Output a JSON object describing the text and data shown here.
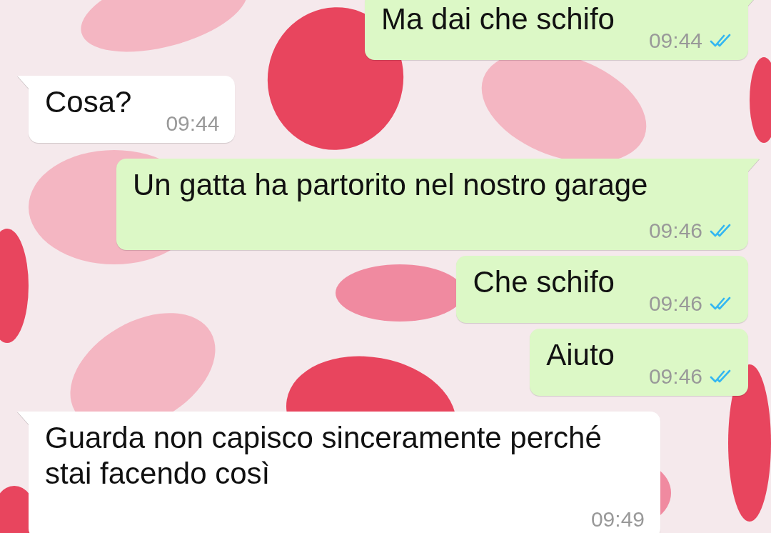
{
  "messages": [
    {
      "outgoing": true,
      "text": "Ma dai che schifo",
      "time": "09:44",
      "read": true
    },
    {
      "outgoing": false,
      "text": "Cosa?",
      "time": "09:44"
    },
    {
      "outgoing": true,
      "text": "Un gatta ha partorito nel nostro garage",
      "time": "09:46",
      "read": true
    },
    {
      "outgoing": true,
      "text": "Che schifo",
      "time": "09:46",
      "read": true
    },
    {
      "outgoing": true,
      "text": "Aiuto",
      "time": "09:46",
      "read": true
    },
    {
      "outgoing": false,
      "text": "Guarda non capisco sinceramente perché stai facendo così",
      "time": "09:49"
    }
  ]
}
